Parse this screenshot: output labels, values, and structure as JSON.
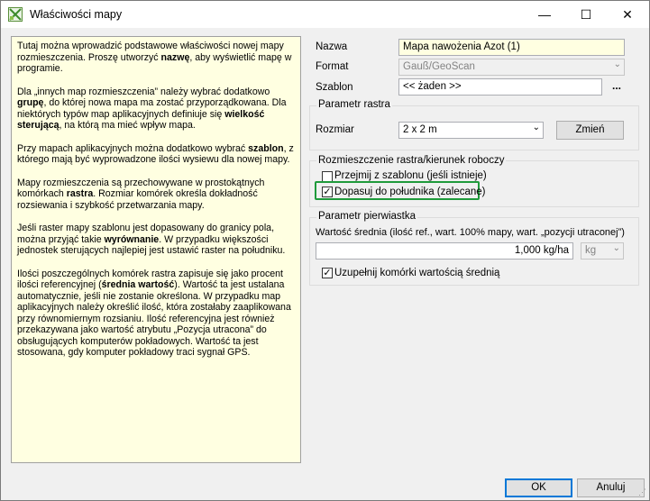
{
  "window": {
    "title": "Właściwości mapy"
  },
  "titlebar_controls": {
    "minimize": "—",
    "maximize": "☐",
    "close": "✕"
  },
  "help": {
    "paragraphs": [
      [
        {
          "t": "Tutaj można wprowadzić podstawowe właściwości nowej mapy rozmieszczenia. Proszę utworzyć "
        },
        {
          "t": "nazwę",
          "b": true
        },
        {
          "t": ", aby wyświetlić mapę w programie."
        }
      ],
      [
        {
          "t": "Dla „innych map rozmieszczenia” należy wybrać dodatkowo "
        },
        {
          "t": "grupę",
          "b": true
        },
        {
          "t": ", do której nowa mapa ma zostać przyporządkowana. Dla niektórych typów map aplikacyjnych definiuje się "
        },
        {
          "t": "wielkość sterującą",
          "b": true
        },
        {
          "t": ", na którą ma mieć wpływ mapa."
        }
      ],
      [
        {
          "t": "Przy mapach aplikacyjnych można dodatkowo wybrać "
        },
        {
          "t": "szablon",
          "b": true
        },
        {
          "t": ", z którego mają być wyprowadzone ilości wysiewu dla nowej mapy."
        }
      ],
      [
        {
          "t": "Mapy rozmieszczenia są przechowywane w prostokątnych komórkach "
        },
        {
          "t": "rastra",
          "b": true
        },
        {
          "t": ". Rozmiar komórek określa dokładność rozsiewania i szybkość przetwarzania mapy."
        }
      ],
      [
        {
          "t": "Jeśli raster mapy szablonu jest dopasowany do granicy pola, można przyjąć takie "
        },
        {
          "t": "wyrównanie",
          "b": true
        },
        {
          "t": ". W przypadku większości jednostek sterujących najlepiej jest ustawić raster na południku."
        }
      ],
      [
        {
          "t": "Ilości poszczególnych komórek rastra zapisuje się jako procent ilości referencyjnej ("
        },
        {
          "t": "średnia wartość",
          "b": true
        },
        {
          "t": "). Wartość ta jest ustalana automatycznie, jeśli nie zostanie określona. W przypadku map aplikacyjnych należy określić ilość, która zostałaby zaaplikowana przy równomiernym rozsianiu. Ilość referencyjna jest również przekazywana jako wartość atrybutu „Pozycja utracona” do obsługujących komputerów pokładowych. Wartość ta jest stosowana, gdy komputer pokładowy traci sygnał GPS."
        }
      ]
    ]
  },
  "form": {
    "name_label": "Nazwa",
    "name_value": "Mapa nawożenia Azot (1)",
    "format_label": "Format",
    "format_value": "Gauß/GeoScan",
    "template_label": "Szablon",
    "template_value": "<< żaden >>",
    "template_browse": "..."
  },
  "raster": {
    "group_title": "Parametr rastra",
    "size_label": "Rozmiar",
    "size_value": "2 x 2 m",
    "change_button": "Zmień"
  },
  "alignment": {
    "group_title": "Rozmieszczenie rastra/kierunek roboczy",
    "option_from_template": "Przejmij z szablonu (jeśli istnieje)",
    "option_meridian": "Dopasuj do południka (zalecane)",
    "option_meridian_checked": true,
    "option_from_template_checked": false
  },
  "root_param": {
    "group_title": "Parametr pierwiastka",
    "mean_label": "Wartość średnia (ilość ref., wart. 100% mapy, wart. „pozycji utraconej”)",
    "mean_value": "1,000 kg/ha",
    "unit_value": "kg",
    "fill_cells_label": "Uzupełnij komórki wartością średnią",
    "fill_cells_checked": true
  },
  "buttons": {
    "ok": "OK",
    "cancel": "Anuluj"
  },
  "colors": {
    "help_bg": "#ffffe1",
    "highlight": "#1f9a3b",
    "default_button": "#0078d7"
  }
}
